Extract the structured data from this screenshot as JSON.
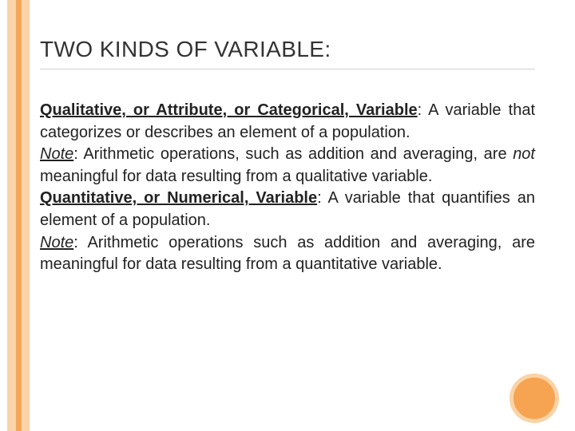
{
  "title": "TWO KINDS OF VARIABLE:",
  "p1_bold_term": "Qualitative, or Attribute, or Categorical, Variable",
  "p1_after": ": A variable that categorizes or describes an element of a population.",
  "note_label_1": "Note",
  "note1_a": ": Arithmetic operations, such as addition and averaging, are ",
  "note1_not": "not",
  "note1_b": " meaningful for data resulting from a qualitative variable.",
  "p2_bold_term": "Quantitative, or Numerical, Variable",
  "p2_after": ": A variable that quantifies an element of a population.",
  "note_label_2": "Note",
  "note2": ": Arithmetic operations such as addition and averaging, are meaningful for data resulting from a quantitative variable."
}
